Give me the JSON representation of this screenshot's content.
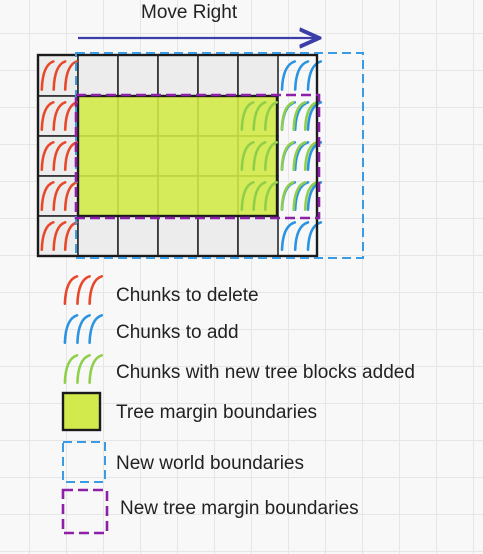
{
  "title": "Move Right",
  "colors": {
    "delete": "#e8472a",
    "add": "#2b93e0",
    "tree_added": "#8fcf4a",
    "tree_margin_fill": "#d2ea4c",
    "world_boundary": "#3a9be3",
    "tree_margin_boundary": "#8e1fa8",
    "arrow": "#3b3ea8",
    "grid_cell": "#ececec"
  },
  "grid": {
    "columns": 6,
    "rows": 5
  },
  "chunks": {
    "delete": {
      "column": 0,
      "rows": [
        0,
        1,
        2,
        3,
        4
      ]
    },
    "add": {
      "column": 6,
      "rows": [
        0,
        1,
        2,
        3,
        4
      ]
    },
    "tree_added": {
      "columns": [
        5,
        6
      ],
      "rows": [
        1,
        2,
        3
      ]
    },
    "tree_margin": {
      "columns": [
        1,
        5
      ],
      "rows": [
        1,
        3
      ]
    }
  },
  "legend": [
    {
      "icon": "red-hatch-icon",
      "label": "Chunks to delete"
    },
    {
      "icon": "blue-hatch-icon",
      "label": "Chunks to add"
    },
    {
      "icon": "green-hatch-icon",
      "label": "Chunks with new tree blocks added"
    },
    {
      "icon": "green-box-icon",
      "label": "Tree margin boundaries"
    },
    {
      "icon": "blue-dashed-box-icon",
      "label": "New world boundaries"
    },
    {
      "icon": "purple-dashed-box-icon",
      "label": "New tree margin boundaries"
    }
  ]
}
